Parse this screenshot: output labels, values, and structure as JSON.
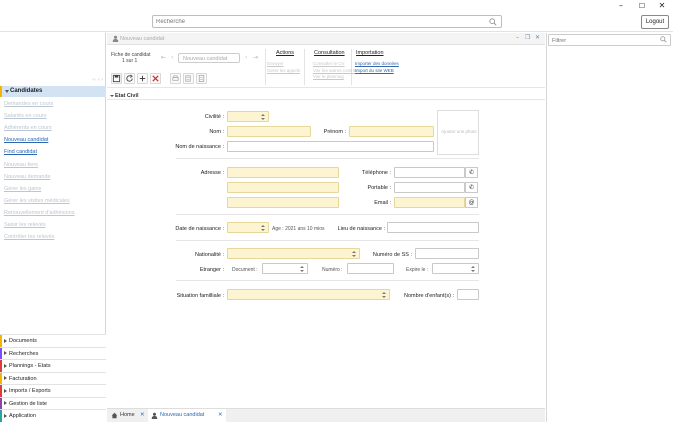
{
  "window": {
    "minimize": "–",
    "maximize": "☐",
    "close": "✕"
  },
  "header": {
    "search_placeholder": "Recherche",
    "logout_label": "Logout"
  },
  "sidebar": {
    "collapse_hint": "‹‹ ‹ ›",
    "section_label": "Candidates",
    "links": [
      {
        "label": "Demandes en cours",
        "active": false
      },
      {
        "label": "Salariés en cours",
        "active": false
      },
      {
        "label": "Adhérents en cours",
        "active": false
      },
      {
        "label": "Nouveau candidat",
        "active": true
      },
      {
        "label": "Find candidat",
        "active": true
      },
      {
        "label": "Nouveau tiers",
        "active": false
      },
      {
        "label": "Nouveau demande",
        "active": false
      },
      {
        "label": "Gérer les gains",
        "active": false
      },
      {
        "label": "Gérer les visites médicales",
        "active": false
      },
      {
        "label": "Renouvellement d'adhésions",
        "active": false
      },
      {
        "label": "Saisir les relevés",
        "active": false
      },
      {
        "label": "Contrôler les relevés",
        "active": false
      }
    ],
    "bottom_menus": [
      {
        "label": "Documents",
        "color": "#f4b400"
      },
      {
        "label": "Recherches",
        "color": "#7c4dff"
      },
      {
        "label": "Plannings - Etats",
        "color": "#e53935"
      },
      {
        "label": "Facturation",
        "color": "#f4b400"
      },
      {
        "label": "Imports / Exports",
        "color": "#e53935"
      },
      {
        "label": "Gestion de liste",
        "color": "#8e44ad"
      },
      {
        "label": "Application",
        "color": "#26a69a"
      }
    ]
  },
  "panel": {
    "title": "Nouveau candidat",
    "controls": {
      "minimize": "–",
      "restore": "❐",
      "close": "✕"
    }
  },
  "toolbar": {
    "record_label": "Fiche de candidat",
    "record_count": "1 sur 1",
    "nav_first": "⇤",
    "nav_prev": "‹",
    "record_select": "Nouveau candidat",
    "nav_next": "›",
    "nav_last": "⇥",
    "groups": [
      {
        "title": "Actions",
        "links": [
          {
            "label": "Envoyer",
            "on": false
          },
          {
            "label": "Gérer les appels",
            "on": false
          }
        ]
      },
      {
        "title": "Consultation",
        "links": [
          {
            "label": "Consulter le CV",
            "on": false
          },
          {
            "label": "Voir les autres contrats",
            "on": false
          },
          {
            "label": "Voir le planning",
            "on": false
          }
        ]
      },
      {
        "title": "Importation",
        "links": [
          {
            "label": "Importer des données",
            "on": true
          },
          {
            "label": "Import du site WEB",
            "on": true
          }
        ]
      }
    ]
  },
  "section": {
    "title": "Etat Civil"
  },
  "form": {
    "civilite": "Civilité :",
    "nom": "Nom :",
    "prenom": "Prénom :",
    "nom_naissance": "Nom de naissance :",
    "photo_placeholder": "Ajouter une photo",
    "adresse": "Adresse :",
    "telephone": "Téléphone :",
    "portable": "Portable :",
    "email": "Email :",
    "date_naissance": "Date de naissance :",
    "age": "Age : 2021 ans 10 mios",
    "lieu_naissance": "Lieu de naissance :",
    "nationalite": "Nationalité :",
    "num_ss": "Numéro de SS :",
    "etranger": "Etranger :",
    "document": "Document :",
    "numero": "Numéro :",
    "expire": "Expire le :",
    "situation": "Situation familliale :",
    "nb_enfants": "Nombre d'enfant(s) :",
    "phone_glyph": "✆",
    "at_glyph": "@"
  },
  "tabs": [
    {
      "label": "Home",
      "close": "✕",
      "icon": "home-icon"
    },
    {
      "label": "Nouveau candidat",
      "close": "✕",
      "icon": "user-icon"
    }
  ],
  "filter": {
    "placeholder": "Filtrer"
  }
}
